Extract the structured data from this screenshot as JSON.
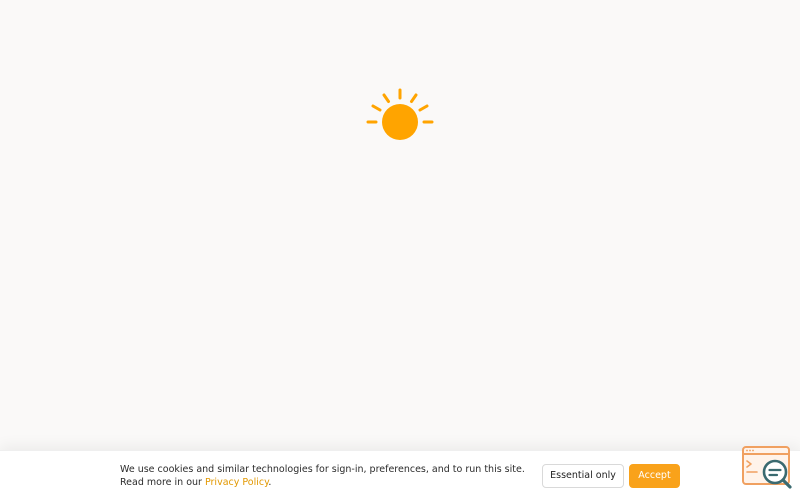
{
  "colors": {
    "background": "#faf9f8",
    "accent": "#f9a21a",
    "sun": "#ffa400",
    "link": "#e29800",
    "widget_outline": "#f0a060",
    "widget_magnifier": "#3a6a70"
  },
  "loader": {
    "icon": "sun-icon"
  },
  "cookie_banner": {
    "message": "We use cookies and similar technologies for sign-in, preferences, and to run this site. Read more in our ",
    "link_text": "Privacy Policy",
    "trailing": ".",
    "essential_label": "Essential only",
    "accept_label": "Accept"
  },
  "widget": {
    "icon": "browser-search-icon"
  }
}
